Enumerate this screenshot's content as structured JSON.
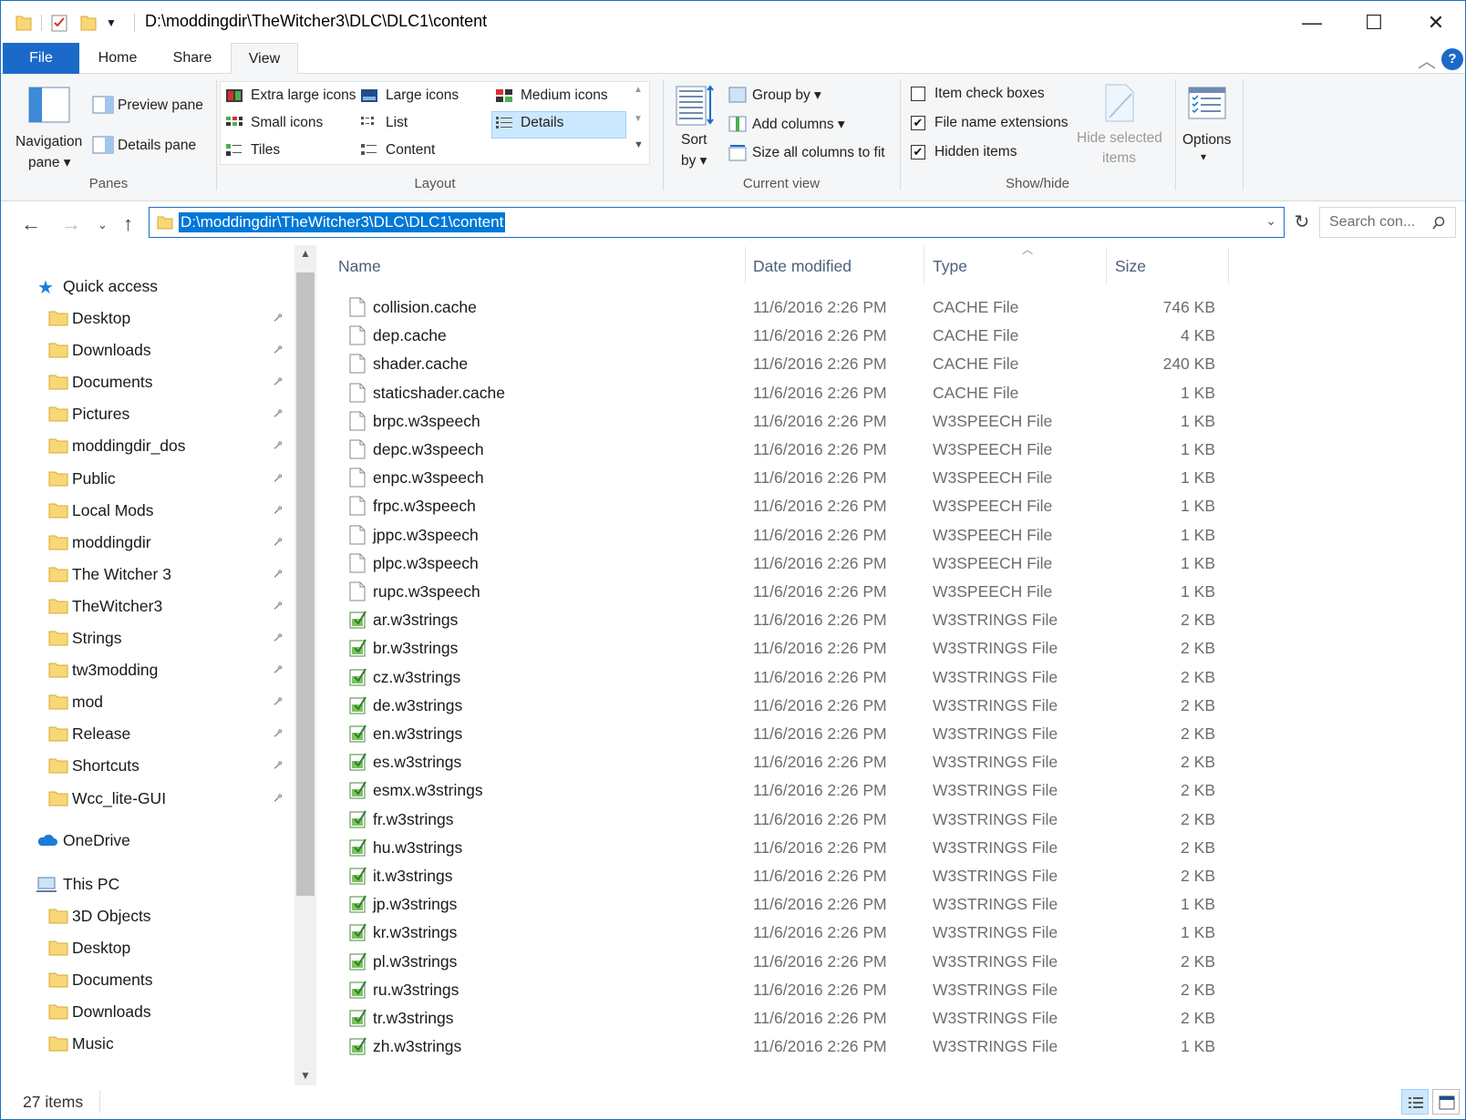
{
  "window": {
    "title": "D:\\moddingdir\\TheWitcher3\\DLC\\DLC1\\content",
    "minimize": "—",
    "maximize": "☐",
    "close": "✕"
  },
  "ribbon_tabs": [
    "File",
    "Home",
    "Share",
    "View"
  ],
  "ribbon": {
    "panes": {
      "navigation_pane": "Navigation",
      "navigation_pane_2": "pane ▾",
      "preview_pane": "Preview pane",
      "details_pane": "Details pane",
      "group": "Panes"
    },
    "layout": {
      "options": [
        "Extra large icons",
        "Large icons",
        "Medium icons",
        "Small icons",
        "List",
        "Details",
        "Tiles",
        "Content"
      ],
      "selected": "Details",
      "group": "Layout"
    },
    "current_view": {
      "sort_by": "Sort",
      "sort_by_2": "by ▾",
      "group_by": "Group by ▾",
      "add_columns": "Add columns ▾",
      "size_all": "Size all columns to fit",
      "group": "Current view"
    },
    "show_hide": {
      "item_check_boxes": "Item check boxes",
      "item_check_boxes_checked": false,
      "file_name_extensions": "File name extensions",
      "file_name_extensions_checked": true,
      "hidden_items": "Hidden items",
      "hidden_items_checked": true,
      "hide_selected": "Hide selected",
      "hide_selected_2": "items",
      "group": "Show/hide"
    },
    "options": {
      "label": "Options",
      "arrow": "▾"
    }
  },
  "address": {
    "path": "D:\\moddingdir\\TheWitcher3\\DLC\\DLC1\\content",
    "search_placeholder": "Search con..."
  },
  "nav": {
    "quick_access": "Quick access",
    "quick_items": [
      "Desktop",
      "Downloads",
      "Documents",
      "Pictures",
      "moddingdir_dos",
      "Public",
      "Local Mods",
      "moddingdir",
      "The Witcher 3",
      "TheWitcher3",
      "Strings",
      "tw3modding",
      "mod",
      "Release",
      "Shortcuts",
      "Wcc_lite-GUI"
    ],
    "onedrive": "OneDrive",
    "this_pc": "This PC",
    "pc_items": [
      "3D Objects",
      "Desktop",
      "Documents",
      "Downloads",
      "Music"
    ]
  },
  "columns": {
    "name": "Name",
    "date": "Date modified",
    "type": "Type",
    "size": "Size"
  },
  "files": [
    {
      "name": "collision.cache",
      "date": "11/6/2016 2:26 PM",
      "type": "CACHE File",
      "size": "746 KB",
      "kind": "blank"
    },
    {
      "name": "dep.cache",
      "date": "11/6/2016 2:26 PM",
      "type": "CACHE File",
      "size": "4 KB",
      "kind": "blank"
    },
    {
      "name": "shader.cache",
      "date": "11/6/2016 2:26 PM",
      "type": "CACHE File",
      "size": "240 KB",
      "kind": "blank"
    },
    {
      "name": "staticshader.cache",
      "date": "11/6/2016 2:26 PM",
      "type": "CACHE File",
      "size": "1 KB",
      "kind": "blank"
    },
    {
      "name": "brpc.w3speech",
      "date": "11/6/2016 2:26 PM",
      "type": "W3SPEECH File",
      "size": "1 KB",
      "kind": "blank"
    },
    {
      "name": "depc.w3speech",
      "date": "11/6/2016 2:26 PM",
      "type": "W3SPEECH File",
      "size": "1 KB",
      "kind": "blank"
    },
    {
      "name": "enpc.w3speech",
      "date": "11/6/2016 2:26 PM",
      "type": "W3SPEECH File",
      "size": "1 KB",
      "kind": "blank"
    },
    {
      "name": "frpc.w3speech",
      "date": "11/6/2016 2:26 PM",
      "type": "W3SPEECH File",
      "size": "1 KB",
      "kind": "blank"
    },
    {
      "name": "jppc.w3speech",
      "date": "11/6/2016 2:26 PM",
      "type": "W3SPEECH File",
      "size": "1 KB",
      "kind": "blank"
    },
    {
      "name": "plpc.w3speech",
      "date": "11/6/2016 2:26 PM",
      "type": "W3SPEECH File",
      "size": "1 KB",
      "kind": "blank"
    },
    {
      "name": "rupc.w3speech",
      "date": "11/6/2016 2:26 PM",
      "type": "W3SPEECH File",
      "size": "1 KB",
      "kind": "blank"
    },
    {
      "name": "ar.w3strings",
      "date": "11/6/2016 2:26 PM",
      "type": "W3STRINGS File",
      "size": "2 KB",
      "kind": "strings"
    },
    {
      "name": "br.w3strings",
      "date": "11/6/2016 2:26 PM",
      "type": "W3STRINGS File",
      "size": "2 KB",
      "kind": "strings"
    },
    {
      "name": "cz.w3strings",
      "date": "11/6/2016 2:26 PM",
      "type": "W3STRINGS File",
      "size": "2 KB",
      "kind": "strings"
    },
    {
      "name": "de.w3strings",
      "date": "11/6/2016 2:26 PM",
      "type": "W3STRINGS File",
      "size": "2 KB",
      "kind": "strings"
    },
    {
      "name": "en.w3strings",
      "date": "11/6/2016 2:26 PM",
      "type": "W3STRINGS File",
      "size": "2 KB",
      "kind": "strings"
    },
    {
      "name": "es.w3strings",
      "date": "11/6/2016 2:26 PM",
      "type": "W3STRINGS File",
      "size": "2 KB",
      "kind": "strings"
    },
    {
      "name": "esmx.w3strings",
      "date": "11/6/2016 2:26 PM",
      "type": "W3STRINGS File",
      "size": "2 KB",
      "kind": "strings"
    },
    {
      "name": "fr.w3strings",
      "date": "11/6/2016 2:26 PM",
      "type": "W3STRINGS File",
      "size": "2 KB",
      "kind": "strings"
    },
    {
      "name": "hu.w3strings",
      "date": "11/6/2016 2:26 PM",
      "type": "W3STRINGS File",
      "size": "2 KB",
      "kind": "strings"
    },
    {
      "name": "it.w3strings",
      "date": "11/6/2016 2:26 PM",
      "type": "W3STRINGS File",
      "size": "2 KB",
      "kind": "strings"
    },
    {
      "name": "jp.w3strings",
      "date": "11/6/2016 2:26 PM",
      "type": "W3STRINGS File",
      "size": "1 KB",
      "kind": "strings"
    },
    {
      "name": "kr.w3strings",
      "date": "11/6/2016 2:26 PM",
      "type": "W3STRINGS File",
      "size": "1 KB",
      "kind": "strings"
    },
    {
      "name": "pl.w3strings",
      "date": "11/6/2016 2:26 PM",
      "type": "W3STRINGS File",
      "size": "2 KB",
      "kind": "strings"
    },
    {
      "name": "ru.w3strings",
      "date": "11/6/2016 2:26 PM",
      "type": "W3STRINGS File",
      "size": "2 KB",
      "kind": "strings"
    },
    {
      "name": "tr.w3strings",
      "date": "11/6/2016 2:26 PM",
      "type": "W3STRINGS File",
      "size": "2 KB",
      "kind": "strings"
    },
    {
      "name": "zh.w3strings",
      "date": "11/6/2016 2:26 PM",
      "type": "W3STRINGS File",
      "size": "1 KB",
      "kind": "strings"
    }
  ],
  "status": {
    "count": "27 items"
  },
  "colors": {
    "accent": "#1b6ac9",
    "selection": "#cce8ff",
    "folder": "#f8d775"
  }
}
